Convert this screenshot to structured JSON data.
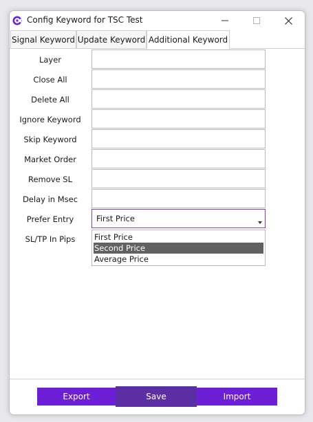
{
  "window": {
    "title": "Config Keyword for TSC Test"
  },
  "tabs": [
    {
      "label": "Signal Keyword"
    },
    {
      "label": "Update Keyword"
    },
    {
      "label": "Additional Keyword",
      "selected": true
    }
  ],
  "form": {
    "fields": [
      {
        "label": "Layer",
        "value": ""
      },
      {
        "label": "Close All",
        "value": ""
      },
      {
        "label": "Delete All",
        "value": ""
      },
      {
        "label": "Ignore Keyword",
        "value": ""
      },
      {
        "label": "Skip Keyword",
        "value": ""
      },
      {
        "label": "Market Order",
        "value": ""
      },
      {
        "label": "Remove SL",
        "value": ""
      },
      {
        "label": "Delay in Msec",
        "value": ""
      }
    ],
    "prefer_entry": {
      "label": "Prefer Entry",
      "selected": "First Price",
      "options": [
        "First Price",
        "Second Price",
        "Average Price"
      ],
      "highlighted": "Second Price"
    },
    "sl_tp_label": "SL/TP In Pips"
  },
  "footer": {
    "export_label": "Export",
    "save_label": "Save",
    "import_label": "Import"
  },
  "colors": {
    "accent": "#6c1fd6",
    "save_pressed": "#5b2fa3",
    "dropdown_highlight": "#616161"
  },
  "icons": {
    "app": "app-logo-icon",
    "minimize": "minimize-icon",
    "maximize": "maximize-icon",
    "close": "close-icon",
    "dropdown": "chevron-down-icon"
  }
}
